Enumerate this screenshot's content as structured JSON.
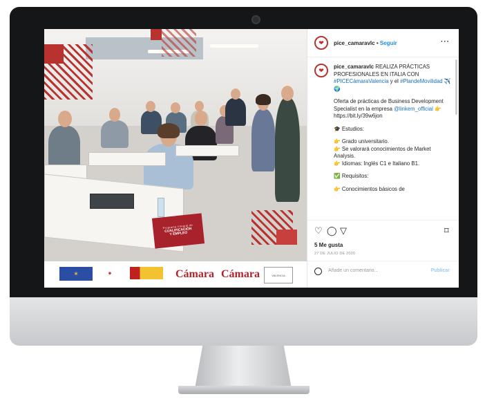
{
  "post": {
    "username": "pice_camaravlc",
    "separator": "•",
    "follow_label": "Seguir",
    "more_label": "···",
    "caption": {
      "line1_user": "pice_camaravlc",
      "line1_text": " REALIZA PRÁCTICAS PROFESIONALES EN ITALIA CON ",
      "hashtag1": "#PICECámaraValencia",
      "mid": " y el ",
      "hashtag2": "#PlandeMovilidad",
      "emojis1": " ✈️ 🌍",
      "offer_text": "Oferta de prácticas de Business Development Specialist en la empresa ",
      "mention": "@linkem_official",
      "hand1": " 👉",
      "url": "https://bit.ly/39w6jon",
      "studies": "🎓 Estudios:",
      "grado": "👉 Grado universitario.",
      "market": "👉 Se valorará conocimientos de Market Analysis.",
      "idiomas": "👉 Idiomas: Inglés C1 e Italiano B1.",
      "requisitos": "✅ Requisitos:",
      "cut": "👉 Conocimientos básicos de"
    },
    "likes": "5 Me gusta",
    "date": "27 DE JULIO DE 2020",
    "comment_placeholder": "Añade un comentario...",
    "publish_label": "Publicar",
    "icons": {
      "like": "heart-icon",
      "comment": "comment-icon",
      "share": "send-icon",
      "save": "bookmark-icon"
    }
  },
  "photo": {
    "badge_line1": "Programa Integral de",
    "badge_line2": "CUALIFICACIÓN",
    "badge_line3": "Y EMPLEO",
    "logo_camara1": "Cámara",
    "logo_camara2": "Cámara",
    "logo_val": "VALENCIA"
  },
  "colors": {
    "brand_red": "#b8332f",
    "link_blue": "#1a6fb8",
    "follow_blue": "#1a8de6"
  }
}
